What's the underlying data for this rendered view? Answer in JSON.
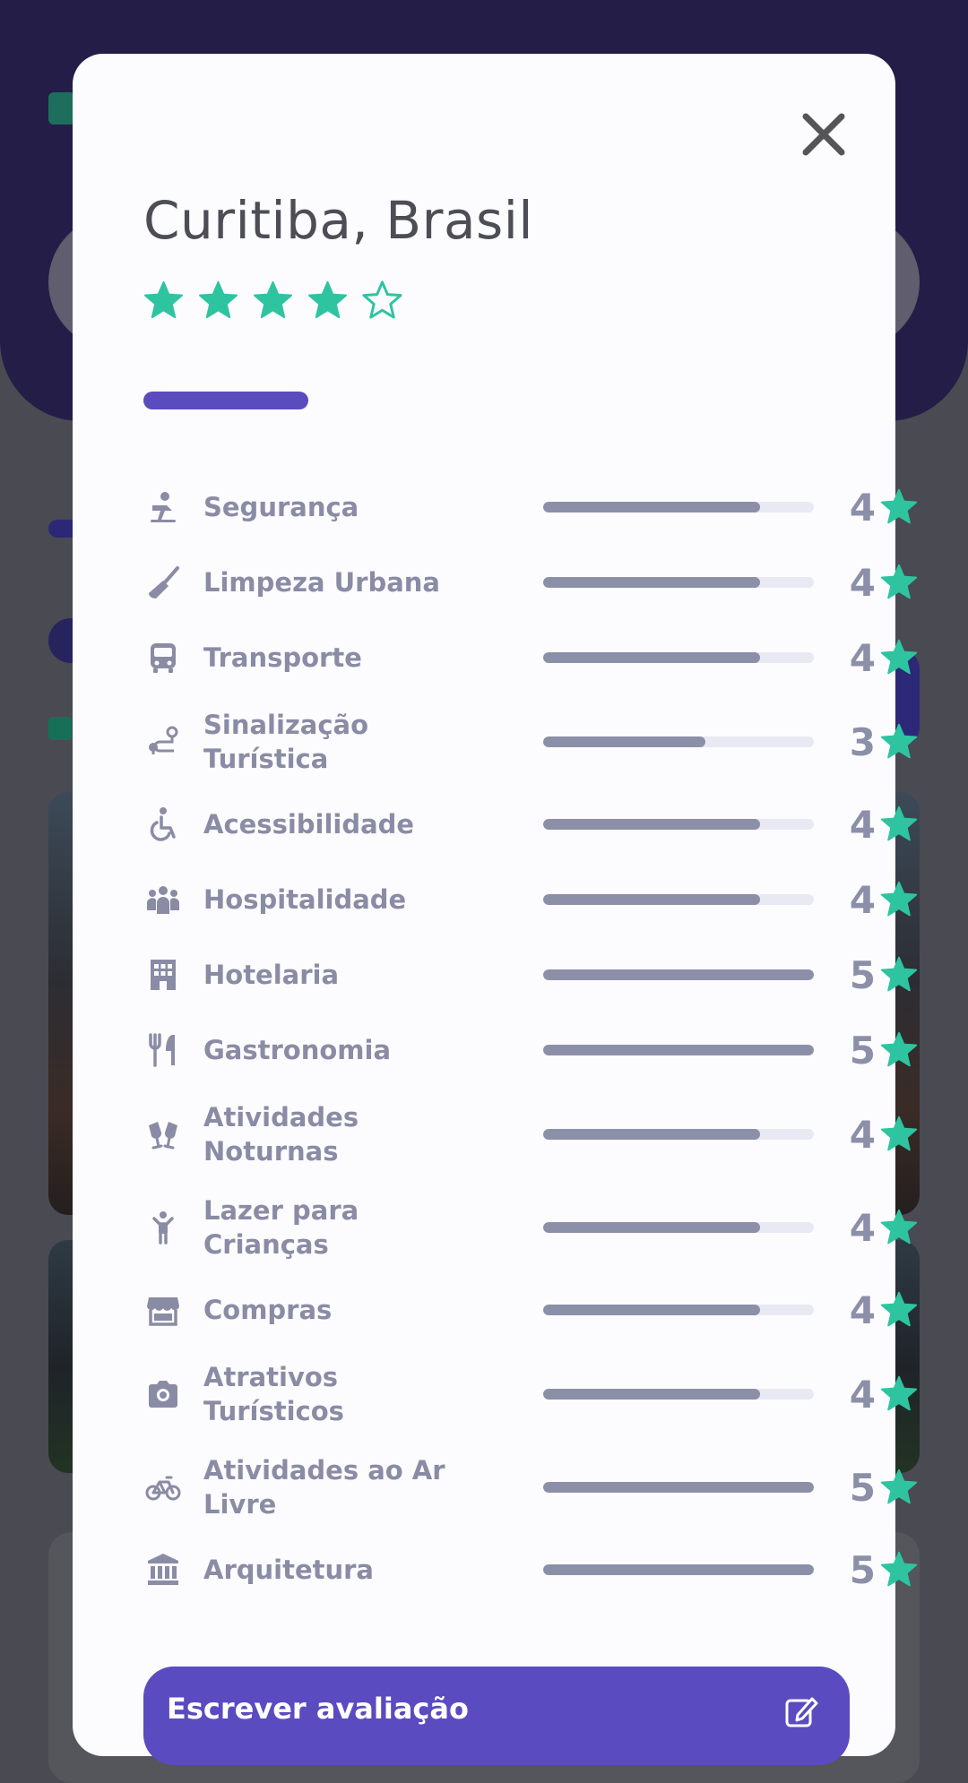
{
  "modal": {
    "title": "Curitiba, Brasil",
    "overall_rating": 4,
    "overall_max": 5,
    "close_icon": "close-icon"
  },
  "categories": [
    {
      "label": "Segurança",
      "icon": "security-icon",
      "score": "4",
      "fill": 0.8
    },
    {
      "label": "Limpeza Urbana",
      "icon": "broom-icon",
      "score": "4",
      "fill": 0.8
    },
    {
      "label": "Transporte",
      "icon": "bus-icon",
      "score": "4",
      "fill": 0.8
    },
    {
      "label": "Sinalização Turística",
      "icon": "route-icon",
      "score": "3",
      "fill": 0.6
    },
    {
      "label": "Acessibilidade",
      "icon": "wheelchair-icon",
      "score": "4",
      "fill": 0.8
    },
    {
      "label": "Hospitalidade",
      "icon": "people-icon",
      "score": "4",
      "fill": 0.8
    },
    {
      "label": "Hotelaria",
      "icon": "building-icon",
      "score": "5",
      "fill": 1.0
    },
    {
      "label": "Gastronomia",
      "icon": "utensils-icon",
      "score": "5",
      "fill": 1.0
    },
    {
      "label": "Atividades Noturnas",
      "icon": "glasses-cheers-icon",
      "score": "4",
      "fill": 0.8
    },
    {
      "label": "Lazer para Crianças",
      "icon": "child-icon",
      "score": "4",
      "fill": 0.8
    },
    {
      "label": "Compras",
      "icon": "store-icon",
      "score": "4",
      "fill": 0.8
    },
    {
      "label": "Atrativos Turísticos",
      "icon": "camera-icon",
      "score": "4",
      "fill": 0.8
    },
    {
      "label": "Atividades ao Ar Livre",
      "icon": "bicycle-icon",
      "score": "5",
      "fill": 1.0
    },
    {
      "label": "Arquitetura",
      "icon": "landmark-icon",
      "score": "5",
      "fill": 1.0
    }
  ],
  "write_review": {
    "label": "Escrever avaliação",
    "icon": "edit-icon"
  },
  "colors": {
    "accent": "#5a4bbe",
    "star": "#2ec4a0",
    "muted": "#8a8ca5"
  }
}
